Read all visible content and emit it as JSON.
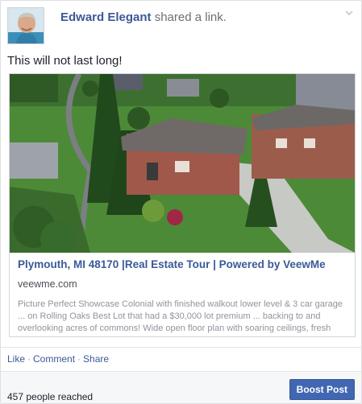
{
  "post": {
    "author": "Edward Elegant",
    "action_text": "shared a link.",
    "message": "This will not last long!",
    "options_icon": "chevron-down-icon"
  },
  "link": {
    "title": "Plymouth, MI 48170 |Real Estate Tour | Powered by VeewMe",
    "domain": "veewme.com",
    "description": "Picture Perfect Showcase Colonial with finished walkout lower level & 3 car garage ... on Rolling Oaks Best Lot that had a $30,000 lot premium ... backing to and overlooking acres of commons! Wide open floor plan with soaring ceilings, fresh neutral paint &..."
  },
  "actions": {
    "like": "Like",
    "comment": "Comment",
    "share": "Share",
    "separator": "·"
  },
  "footer": {
    "reach": "457 people reached",
    "boost_label": "Boost Post"
  },
  "colors": {
    "link_blue": "#3b5998",
    "boost_blue": "#4267b2",
    "muted_text": "#90949c"
  }
}
